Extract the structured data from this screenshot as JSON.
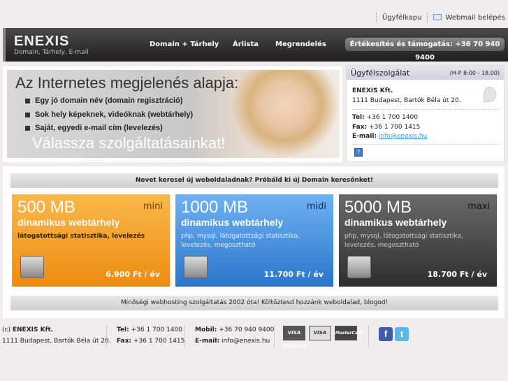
{
  "toplinks": {
    "client": "Ügyfélkapu",
    "webmail": "Webmail belépés"
  },
  "header": {
    "logo": "ENEXIS",
    "tagline": "Domain, Tárhely, E-mail",
    "nav": [
      "Domain + Tárhely",
      "Árlista",
      "Megrendelés"
    ],
    "sales": "Értékesítés és támogatás: +36 70 940 9400"
  },
  "banner": {
    "title": "Az Internetes megjelenés alapja:",
    "bullets": [
      "Egy jó domain név (domain regisztráció)",
      "Sok hely képeknek, videóknak (webtárhely)",
      "Saját, egyedi e-mail cím (levelezés)"
    ],
    "cta": "Válassza szolgáltatásainkat!"
  },
  "support": {
    "title": "Ügyfélszolgálat",
    "hours": "(H-P 8:00 - 18.00)",
    "company": "ENEXIS Kft.",
    "address": "1111 Budapest, Bartók Béla út 20.",
    "tel_label": "Tel:",
    "tel": "+36 1 700 1400",
    "fax_label": "Fax:",
    "fax": "+36 1 700 1415",
    "email_label": "E-mail:",
    "email": "info@enexis.hu"
  },
  "domain": {
    "search_prompt": "Nevet keresel új weboldaladnak? Próbáld ki új Domain keresőnket!",
    "bottom": "Minőségi webhosting szolgáltatás 2002 óta! Költöztesd hozzánk weboldalad, blogod!"
  },
  "plans": [
    {
      "size": "500 MB",
      "tier": "mini",
      "subtitle": "dinamikus webtárhely",
      "features": "látogatottsági statisztika, levelezés",
      "price": "6.900 Ft / év",
      "color": "#f5a623"
    },
    {
      "size": "1000 MB",
      "tier": "midi",
      "subtitle": "dinamikus webtárhely",
      "features": "php, mysql, látogatottsági statisztika, levelezés, megosztható",
      "price": "11.700 Ft / év",
      "color": "#3d8fe0"
    },
    {
      "size": "5000 MB",
      "tier": "maxi",
      "subtitle": "dinamikus webtárhely",
      "features": "php, mysql, látogatottsági statisztika, levelezés, megosztható",
      "price": "18.700 Ft / év",
      "color": "#444444"
    }
  ],
  "footer": {
    "copyright": "(c)",
    "company": "ENEXIS Kft.",
    "address": "1111 Budapest, Bartók Béla út 20.",
    "tel_label": "Tel:",
    "tel": "+36 1 700 1400",
    "fax_label": "Fax:",
    "fax": "+36 1 700 1415",
    "mobil_label": "Mobil:",
    "mobil": "+36 70 940 9400",
    "email_label": "E-mail:",
    "email": "info@enexis.hu",
    "cards": [
      "VISA Electron",
      "VISA",
      "MasterCard"
    ]
  }
}
